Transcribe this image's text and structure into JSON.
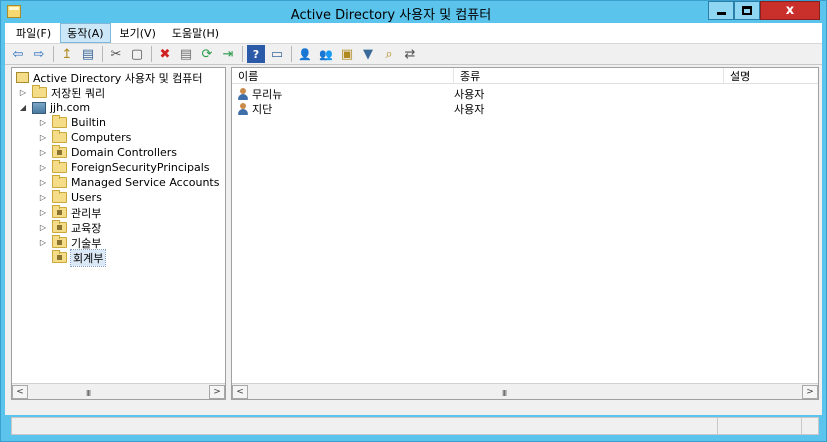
{
  "window": {
    "title": "Active Directory 사용자 및 컴퓨터",
    "min_glyph": "",
    "close_glyph": "x"
  },
  "menu": [
    {
      "label": "파일(F)"
    },
    {
      "label": "동작(A)",
      "active": true
    },
    {
      "label": "보기(V)"
    },
    {
      "label": "도움말(H)"
    }
  ],
  "toolbar": {
    "back": "⇦",
    "forward": "⇨",
    "up": "↥",
    "show_tree": "▤",
    "cut": "✂",
    "copy": "▢",
    "delete": "✖",
    "properties": "▤",
    "refresh": "⟳",
    "export": "⇥",
    "help": "?",
    "console": "▭",
    "new_user": "👤",
    "new_group": "👥",
    "new_ou": "▣",
    "filter": "▼",
    "find": "⌕",
    "add_to_group": "⇄"
  },
  "tree": {
    "root": "Active Directory 사용자 및 컴퓨터",
    "saved_queries": "저장된 쿼리",
    "domain": "jjh.com",
    "containers": [
      {
        "label": "Builtin",
        "ou": false
      },
      {
        "label": "Computers",
        "ou": false
      },
      {
        "label": "Domain Controllers",
        "ou": true
      },
      {
        "label": "ForeignSecurityPrincipals",
        "ou": false
      },
      {
        "label": "Managed Service Accounts",
        "ou": false
      },
      {
        "label": "Users",
        "ou": false
      },
      {
        "label": "관리부",
        "ou": true
      },
      {
        "label": "교육장",
        "ou": true
      },
      {
        "label": "기술부",
        "ou": true
      },
      {
        "label": "회계부",
        "ou": true,
        "selected": true
      }
    ]
  },
  "list": {
    "columns": [
      "이름",
      "종류",
      "설명"
    ],
    "rows": [
      {
        "name": "무리뉴",
        "type": "사용자",
        "desc": ""
      },
      {
        "name": "지단",
        "type": "사용자",
        "desc": ""
      }
    ]
  },
  "scroll": {
    "left_arrow": "<",
    "right_arrow": ">",
    "grip": "III"
  },
  "colors": {
    "titlebar": "#5bc4ec",
    "close": "#c9302c",
    "selection": "#dbe9f6"
  }
}
